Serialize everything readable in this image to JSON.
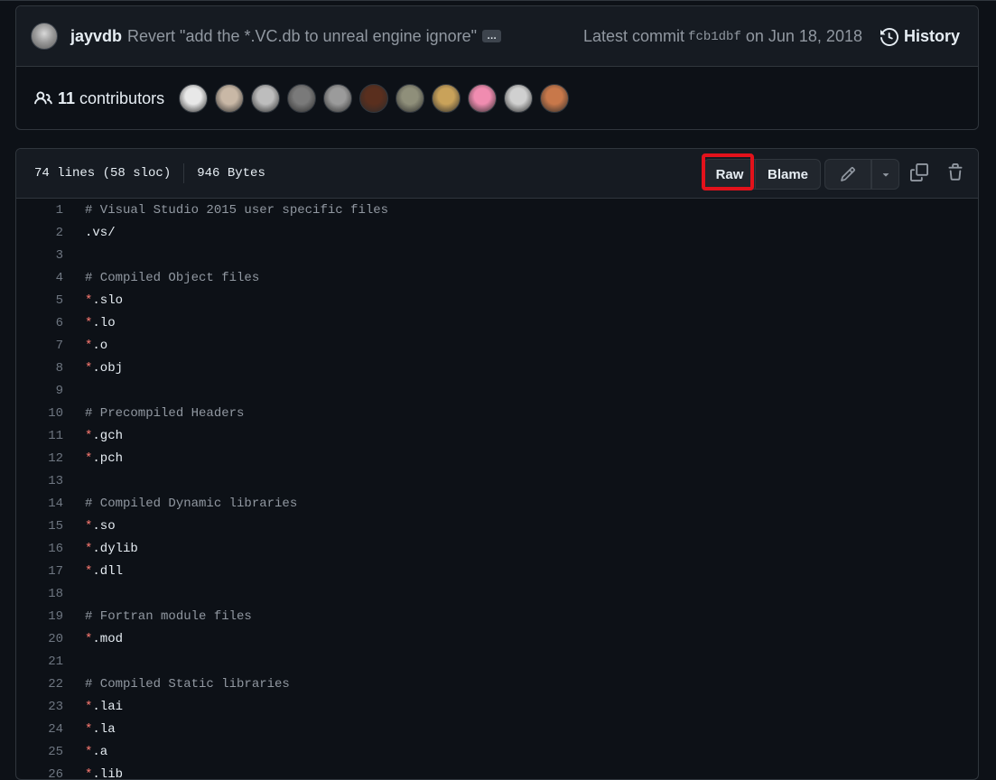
{
  "commit": {
    "author": "jayvdb",
    "message": "Revert \"add the *.VC.db to unreal engine ignore\"",
    "ellipsis": "…",
    "latest_label": "Latest commit",
    "sha": "fcb1dbf",
    "date": "on Jun 18, 2018",
    "history_label": "History"
  },
  "contributors": {
    "count": "11",
    "label": "contributors",
    "avatar_colors": [
      "#e8e8e8",
      "#c9b8a6",
      "#bdbdbd",
      "#7a7a7a",
      "#9b9b9b",
      "#5a2f1e",
      "#8f8f7a",
      "#c9a25a",
      "#f08cb0",
      "#d0d0d0",
      "#c8784a"
    ]
  },
  "file": {
    "lines_info": "74 lines (58 sloc)",
    "size": "946 Bytes",
    "raw_label": "Raw",
    "blame_label": "Blame"
  },
  "code_lines": [
    {
      "n": "1",
      "kind": "comment",
      "text": "# Visual Studio 2015 user specific files"
    },
    {
      "n": "2",
      "kind": "plain",
      "text": ".vs/"
    },
    {
      "n": "3",
      "kind": "blank",
      "text": ""
    },
    {
      "n": "4",
      "kind": "comment",
      "text": "# Compiled Object files"
    },
    {
      "n": "5",
      "kind": "glob",
      "text": ".slo"
    },
    {
      "n": "6",
      "kind": "glob",
      "text": ".lo"
    },
    {
      "n": "7",
      "kind": "glob",
      "text": ".o"
    },
    {
      "n": "8",
      "kind": "glob",
      "text": ".obj"
    },
    {
      "n": "9",
      "kind": "blank",
      "text": ""
    },
    {
      "n": "10",
      "kind": "comment",
      "text": "# Precompiled Headers"
    },
    {
      "n": "11",
      "kind": "glob",
      "text": ".gch"
    },
    {
      "n": "12",
      "kind": "glob",
      "text": ".pch"
    },
    {
      "n": "13",
      "kind": "blank",
      "text": ""
    },
    {
      "n": "14",
      "kind": "comment",
      "text": "# Compiled Dynamic libraries"
    },
    {
      "n": "15",
      "kind": "glob",
      "text": ".so"
    },
    {
      "n": "16",
      "kind": "glob",
      "text": ".dylib"
    },
    {
      "n": "17",
      "kind": "glob",
      "text": ".dll"
    },
    {
      "n": "18",
      "kind": "blank",
      "text": ""
    },
    {
      "n": "19",
      "kind": "comment",
      "text": "# Fortran module files"
    },
    {
      "n": "20",
      "kind": "glob",
      "text": ".mod"
    },
    {
      "n": "21",
      "kind": "blank",
      "text": ""
    },
    {
      "n": "22",
      "kind": "comment",
      "text": "# Compiled Static libraries"
    },
    {
      "n": "23",
      "kind": "glob",
      "text": ".lai"
    },
    {
      "n": "24",
      "kind": "glob",
      "text": ".la"
    },
    {
      "n": "25",
      "kind": "glob",
      "text": ".a"
    },
    {
      "n": "26",
      "kind": "glob",
      "text": ".lib"
    }
  ],
  "colors": {
    "accent_highlight": "#e3121b",
    "glob_star": "#ff7b72",
    "background": "#0d1117"
  }
}
